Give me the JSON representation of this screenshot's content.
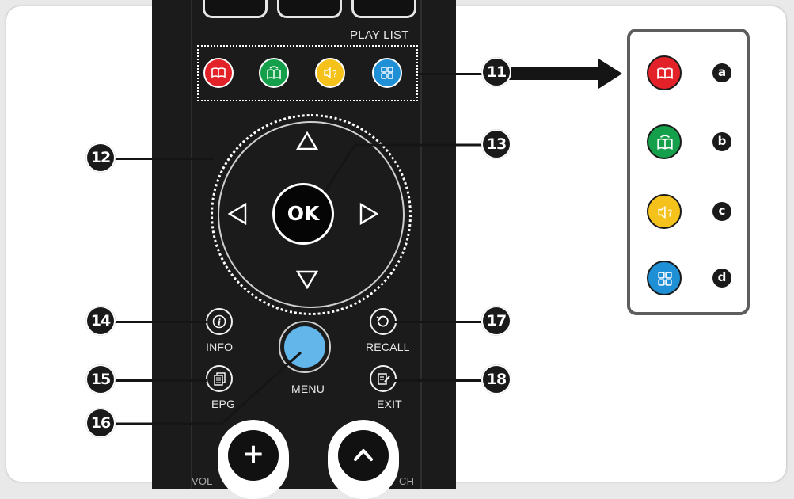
{
  "colors": {
    "red": "#e22128",
    "green": "#14a04a",
    "yellow": "#f5c21b",
    "blue": "#1f8fd6",
    "menu_blue": "#62b6ea",
    "remote_body": "#1b1b1b"
  },
  "remote": {
    "play_list_label": "PLAY LIST",
    "ok_label": "OK",
    "info_label": "INFO",
    "recall_label": "RECALL",
    "epg_label": "EPG",
    "exit_label": "EXIT",
    "menu_label": "MENU",
    "vol_label": "VOL",
    "ch_label": "CH",
    "vol_up_glyph": "+",
    "ch_up_glyph": "^"
  },
  "callouts": {
    "n11": "11",
    "n12": "12",
    "n13": "13",
    "n14": "14",
    "n15": "15",
    "n16": "16",
    "n17": "17",
    "n18": "18"
  },
  "legend": {
    "a": "a",
    "b": "b",
    "c": "c",
    "d": "d",
    "icons": [
      "book-icon",
      "book-refresh-icon",
      "speaker-question-icon",
      "grid-icon"
    ]
  }
}
